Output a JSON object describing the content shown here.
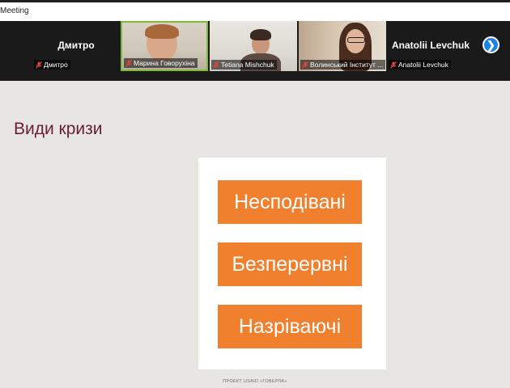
{
  "window": {
    "title": "Meeting"
  },
  "participants": [
    {
      "name": "Дмитро",
      "display_name": "Дмитро",
      "video": false,
      "muted": true
    },
    {
      "name": "Марина Говорухіна",
      "video": true,
      "muted": true,
      "active_speaker": true
    },
    {
      "name": "Tetiana Mishchuk",
      "video": true,
      "muted": true
    },
    {
      "name": "Волинський Інститут ...",
      "video": true,
      "muted": true
    },
    {
      "name": "Anatolii Levchuk",
      "display_name": "Anatolii Levchuk",
      "video": false,
      "muted": true
    }
  ],
  "gallery": {
    "next_icon": "chevron-right-icon",
    "next_glyph": "❯"
  },
  "slide": {
    "title": "Види кризи",
    "items": [
      "Несподівані",
      "Безперервні",
      "Назріваючі"
    ],
    "footer": "ПРОЕКТ USAID «ГОВЕРЛА»"
  },
  "colors": {
    "accent_orange": "#f07f2e",
    "title_color": "#6b1e2e",
    "active_border": "#7fba3c",
    "nav_blue": "#1c83e0"
  }
}
